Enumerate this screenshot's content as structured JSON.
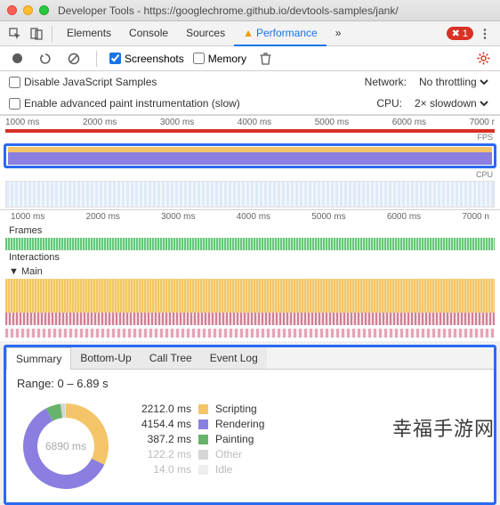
{
  "window": {
    "title": "Developer Tools - https://googlechrome.github.io/devtools-samples/jank/"
  },
  "main_tabs": {
    "items": [
      "Elements",
      "Console",
      "Sources",
      "Performance"
    ],
    "active_index": 3,
    "error_count": "1"
  },
  "perf_toolbar": {
    "screenshots_label": "Screenshots",
    "screenshots_checked": true,
    "memory_label": "Memory",
    "memory_checked": false
  },
  "settings": {
    "disable_js_label": "Disable JavaScript Samples",
    "enable_paint_label": "Enable advanced paint instrumentation (slow)",
    "network_label": "Network:",
    "network_value": "No throttling",
    "cpu_label": "CPU:",
    "cpu_value": "2× slowdown"
  },
  "overview": {
    "ticks": [
      "1000 ms",
      "2000 ms",
      "3000 ms",
      "4000 ms",
      "5000 ms",
      "6000 ms",
      "7000 r"
    ],
    "fps_label": "FPS",
    "cpu_label": "CPU"
  },
  "flame": {
    "ticks": [
      "1000 ms",
      "2000 ms",
      "3000 ms",
      "4000 ms",
      "5000 ms",
      "6000 ms",
      "7000 n"
    ],
    "frames_label": "Frames",
    "interactions_label": "Interactions",
    "main_label": "Main"
  },
  "summary": {
    "tabs": [
      "Summary",
      "Bottom-Up",
      "Call Tree",
      "Event Log"
    ],
    "active_index": 0,
    "range_text": "Range: 0 – 6.89 s",
    "total_ms": "6890 ms",
    "legend": [
      {
        "ms": "2212.0 ms",
        "name": "Scripting",
        "color": "#f4c568"
      },
      {
        "ms": "4154.4 ms",
        "name": "Rendering",
        "color": "#8a7fe0"
      },
      {
        "ms": "387.2 ms",
        "name": "Painting",
        "color": "#67b36b"
      },
      {
        "ms": "122.2 ms",
        "name": "Other",
        "color": "#d6d6d6"
      },
      {
        "ms": "14.0 ms",
        "name": "Idle",
        "color": "#eeeeee"
      }
    ]
  },
  "chart_data": {
    "type": "pie",
    "title": "Time breakdown",
    "series": [
      {
        "name": "Scripting",
        "value": 2212.0,
        "color": "#f4c568"
      },
      {
        "name": "Rendering",
        "value": 4154.4,
        "color": "#8a7fe0"
      },
      {
        "name": "Painting",
        "value": 387.2,
        "color": "#67b36b"
      },
      {
        "name": "Other",
        "value": 122.2,
        "color": "#d6d6d6"
      },
      {
        "name": "Idle",
        "value": 14.0,
        "color": "#eeeeee"
      }
    ],
    "total": 6890
  },
  "watermark": "幸福手游网"
}
